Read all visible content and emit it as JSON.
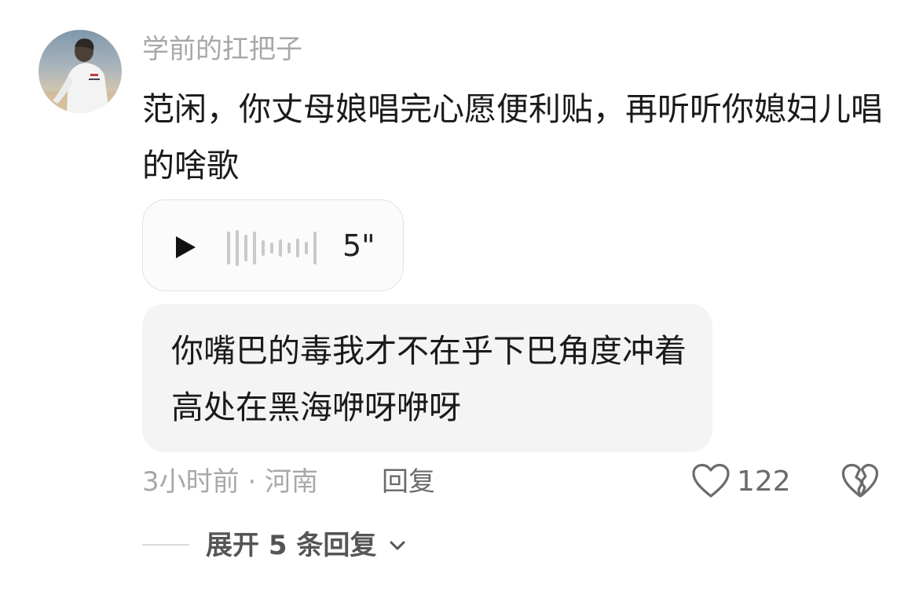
{
  "comment": {
    "username": "学前的扛把子",
    "text": "范闲，你丈母娘唱完心愿便利贴，再听听你媳妇儿唱的啥歌",
    "voice": {
      "duration": "5\""
    },
    "quoted_lyrics": "你嘴巴的毒我才不在乎下巴角度冲着高处在黑海咿呀咿呀",
    "meta": "3小时前 · 河南",
    "reply_label": "回复",
    "like_count": "122",
    "expand_label": "展开 5 条回复"
  },
  "icons": {
    "play": "play-icon",
    "waveform": "waveform-icon",
    "like": "heart-outline-icon",
    "dislike": "broken-heart-icon",
    "expand": "chevron-down-icon"
  },
  "colors": {
    "primary_text": "#1a1a1a",
    "secondary_text": "#a8a8a8",
    "action_text": "#6b6b6b",
    "card_background": "#f4f4f4"
  }
}
